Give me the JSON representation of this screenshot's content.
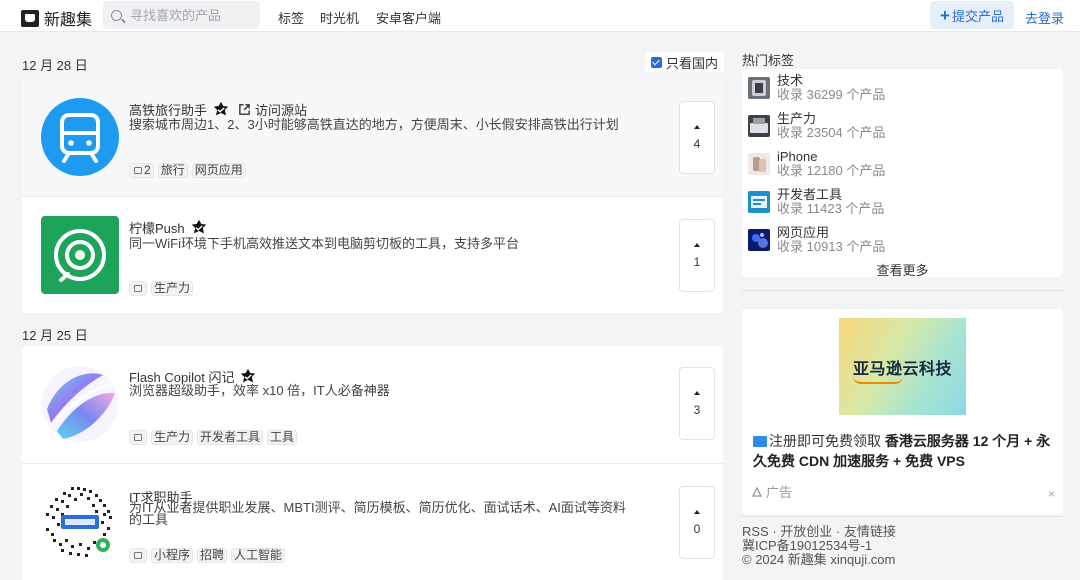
{
  "app": {
    "logo_text": "新趣集"
  },
  "search": {
    "placeholder": "寻找喜欢的产品",
    "value": ""
  },
  "nav": {
    "tags": "标签",
    "timeline": "时光机",
    "android": "安卓客户端",
    "submit": "提交产品",
    "login": "去登录"
  },
  "filter": {
    "domestic_only": "只看国内",
    "checked": true
  },
  "days": [
    {
      "date": "12 月 28 日",
      "products": [
        {
          "name": "高铁旅行助手",
          "verified": true,
          "source_link": "访问源站",
          "desc": "搜索城市周边1、2、3小时能够高铁直达的地方，方便周末、小长假安排高铁出行计划",
          "comments": "2",
          "tags": [
            "旅行",
            "网页应用"
          ],
          "votes": "4",
          "icon": "train-icon",
          "color": "#1e9bf0"
        },
        {
          "name": "柠檬Push",
          "verified": true,
          "desc": "同一WiFi环境下手机高效推送文本到电脑剪切板的工具，支持多平台",
          "comments": "",
          "tags": [
            "生产力"
          ],
          "votes": "1",
          "icon": "lemon-push-icon",
          "color": "#1ea35a"
        }
      ]
    },
    {
      "date": "12 月 25 日",
      "products": [
        {
          "name": "Flash Copilot 闪记",
          "verified": true,
          "desc": "浏览器超级助手，效率 x10 倍，IT人必备神器",
          "comments": "",
          "tags": [
            "生产力",
            "开发者工具",
            "工具"
          ],
          "votes": "3",
          "icon": "flash-copilot-icon"
        },
        {
          "name": "IT求职助手",
          "verified": false,
          "desc": "为IT从业者提供职业发展、MBTI测评、简历模板、简历优化、面试话术、AI面试等资料的工具",
          "comments": "",
          "tags": [
            "小程序",
            "招聘",
            "人工智能"
          ],
          "votes": "0",
          "icon": "qr-code-icon"
        }
      ]
    }
  ],
  "sidebar": {
    "hot_title": "热门标签",
    "tags": [
      {
        "name": "技术",
        "count": "收录 36299 个产品",
        "icon": "tech-thumb"
      },
      {
        "name": "生产力",
        "count": "收录 23504 个产品",
        "icon": "productivity-thumb"
      },
      {
        "name": "iPhone",
        "count": "收录 12180 个产品",
        "icon": "iphone-thumb"
      },
      {
        "name": "开发者工具",
        "count": "收录 11423 个产品",
        "icon": "devtools-thumb"
      },
      {
        "name": "网页应用",
        "count": "收录 10913 个产品",
        "icon": "webapp-thumb"
      }
    ],
    "see_more": "查看更多"
  },
  "ad": {
    "image_text": "亚马逊云科技",
    "text_prefix": "注册即可免费领取 ",
    "text_bold": "香港云服务器 12 个月 + 永久免费 CDN 加速服务 + 免费 VPS",
    "label": "广告",
    "close": "×"
  },
  "footer": {
    "links": "RSS · 开放创业 · 友情链接",
    "icp": "冀ICP备19012534号-1",
    "copyright": "© 2024 新趣集 xinquji.com"
  }
}
